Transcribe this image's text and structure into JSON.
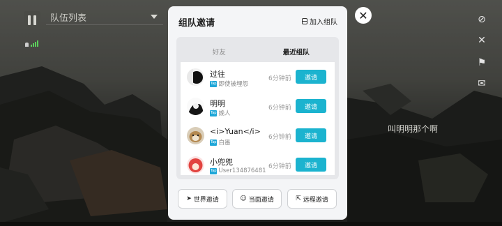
{
  "hud": {
    "team_list_label": "队伍列表",
    "chat_bubble": "叫明明那个啊"
  },
  "modal": {
    "title": "组队邀请",
    "join_team": "加入组队",
    "tabs": [
      {
        "label": "好友",
        "active": false
      },
      {
        "label": "最近组队",
        "active": true
      }
    ],
    "rows": [
      {
        "name": "过往",
        "sub": "即使被埋怨",
        "time": "6分钟前",
        "invite": "邀请"
      },
      {
        "name": "明明",
        "sub": "娩人",
        "time": "6分钟前",
        "invite": "邀请"
      },
      {
        "name": "<i>Yuan</i>",
        "sub": "白墨",
        "time": "6分钟前",
        "invite": "邀请"
      },
      {
        "name": "小兜兜",
        "sub": "User134876481",
        "time": "6分钟前",
        "invite": "邀请"
      }
    ],
    "tap_tag": "Tap",
    "bottom_buttons": [
      {
        "label": "世界邀请",
        "icon": "send-icon"
      },
      {
        "label": "当面邀请",
        "icon": "face-icon"
      },
      {
        "label": "远程邀请",
        "icon": "share-icon"
      }
    ],
    "colors": {
      "accent": "#1bb3cf",
      "tap": "#1fa7d8"
    }
  }
}
